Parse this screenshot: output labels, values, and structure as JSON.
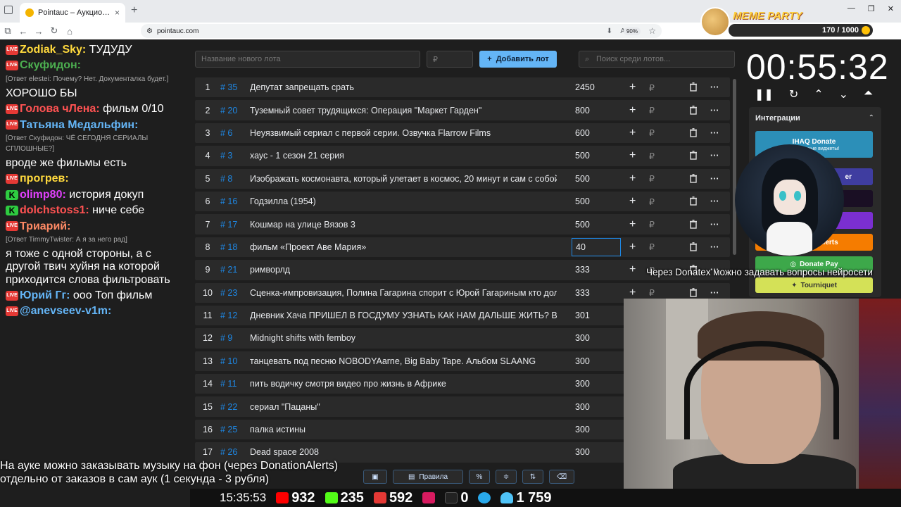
{
  "browser": {
    "tab_title": "Pointauc – Аукционы, лотереи",
    "url": "pointauc.com",
    "zoom": "90%"
  },
  "meme_party": {
    "title": "MEME PARTY",
    "progress": "170 / 1000",
    "progress_fraction": 0.17
  },
  "chat": [
    {
      "nick": "Zodiak_Sky:",
      "color": "#ffd93d",
      "text": "ТУДУДУ",
      "reply": "",
      "badge": "LIVE"
    },
    {
      "nick": "Скуфидон:",
      "color": "#4caf50",
      "text": "",
      "reply": "[Ответ elestei: Почему? Нет. Документалка будет.]",
      "badge": "LIVE"
    },
    {
      "nick": "",
      "color": "#fff",
      "text": "ХОРОШО БЫ",
      "reply": "",
      "badge": ""
    },
    {
      "nick": "Голова чЛена:",
      "color": "#ff5252",
      "text": "фильм 0/10",
      "reply": "",
      "badge": "LIVE"
    },
    {
      "nick": "Татьяна Медальфин:",
      "color": "#64b5f6",
      "text": "",
      "reply": "[Ответ Скуфидон: ЧЁ СЕГОДНЯ СЕРИАЛЫ СПЛОШНЫЕ?]",
      "badge": "LIVE"
    },
    {
      "nick": "",
      "color": "#fff",
      "text": "вроде же фильмы есть",
      "reply": "",
      "badge": ""
    },
    {
      "nick": "прогрев:",
      "color": "#ffd93d",
      "text": "",
      "reply": "",
      "badge": "LIVE"
    },
    {
      "nick": "olimp80:",
      "color": "#e040fb",
      "text": "история докуп",
      "reply": "",
      "badge": "K"
    },
    {
      "nick": "dolchstoss1:",
      "color": "#ff5252",
      "text": "ниче себе",
      "reply": "",
      "badge": "K"
    },
    {
      "nick": "Триарий:",
      "color": "#ff8a65",
      "text": "",
      "reply": "[Ответ TimmyTwister: А я за него рад]",
      "badge": "LIVE"
    },
    {
      "nick": "",
      "color": "#fff",
      "text": "я тоже с одной стороны, а с другой твич хуйня на которой приходится слова фильтровать",
      "reply": "",
      "badge": ""
    },
    {
      "nick": "Юрий Гг:",
      "color": "#64b5f6",
      "text": "ооо Топ фильм",
      "reply": "",
      "badge": "LIVE"
    },
    {
      "nick": "@anevseev-v1m:",
      "color": "#64b5f6",
      "text": "",
      "reply": "",
      "badge": "LIVE"
    }
  ],
  "toolbar": {
    "new_lot_placeholder": "Название нового лота",
    "price_placeholder": "₽",
    "add_label": "Добавить лот",
    "search_placeholder": "Поиск среди лотов..."
  },
  "lots": [
    {
      "n": "1",
      "id": "# 35",
      "name": "Депутат запрещать срать",
      "amount": "2450"
    },
    {
      "n": "2",
      "id": "# 20",
      "name": "Туземный совет трудящихся: Операция \"Маркет Гарден\"",
      "amount": "800"
    },
    {
      "n": "3",
      "id": "# 6",
      "name": "Неуязвимый сериал с первой серии. Озвучка Flarrow Films",
      "amount": "600"
    },
    {
      "n": "4",
      "id": "# 3",
      "name": "хаус - 1 сезон 21 серия",
      "amount": "500"
    },
    {
      "n": "5",
      "id": "# 8",
      "name": "Изображать космонавта, который улетает в космос, 20 минут и сам с собой",
      "amount": "500"
    },
    {
      "n": "6",
      "id": "# 16",
      "name": "Годзилла (1954)",
      "amount": "500"
    },
    {
      "n": "7",
      "id": "# 17",
      "name": "Кошмар на улице Вязов 3",
      "amount": "500"
    },
    {
      "n": "8",
      "id": "# 18",
      "name": "фильм «Проект Аве Мария»",
      "amount": "40"
    },
    {
      "n": "9",
      "id": "# 21",
      "name": "римворлд",
      "amount": "333"
    },
    {
      "n": "10",
      "id": "# 23",
      "name": "Сценка-импровизация, Полина Гагарина спорит с Юрой Гагариным кто дольше",
      "amount": "333"
    },
    {
      "n": "11",
      "id": "# 12",
      "name": "Дневник Хача ПРИШЕЛ В ГОСДУМУ УЗНАТЬ КАК НАМ ДАЛЬШЕ ЖИТЬ? Выпуск",
      "amount": "301"
    },
    {
      "n": "12",
      "id": "# 9",
      "name": "Midnight shifts with femboy",
      "amount": "300"
    },
    {
      "n": "13",
      "id": "# 10",
      "name": "танцевать под песню NOBODYAarne, Big Baby Tape. Альбом SLAANG",
      "amount": "300"
    },
    {
      "n": "14",
      "id": "# 11",
      "name": "пить водичку смотря видео про жизнь в Африке",
      "amount": "300"
    },
    {
      "n": "15",
      "id": "# 22",
      "name": "сериал \"Пацаны\"",
      "amount": "300"
    },
    {
      "n": "16",
      "id": "# 25",
      "name": "палка истины",
      "amount": "300"
    },
    {
      "n": "17",
      "id": "# 26",
      "name": "Dead space 2008",
      "amount": "300"
    }
  ],
  "timer": "00:55:32",
  "integrations": {
    "title": "Интеграции",
    "ihaq_label": "IHAQ Donate",
    "ihaq_sub": "Уникальные виджеты!",
    "alerts_label": "Alerts",
    "donatepay_label": "Donate Pay",
    "tourniquet_label": "Tourniquet",
    "partial_label": "er"
  },
  "overlay_text": "Через Donatex можно задавать вопросы нейросети",
  "subtitle_line1": "На ауке можно заказывать музыку на фон (через DonationAlerts)",
  "subtitle_line2": "отдельно от заказов в сам аук (1 секунда - 3 рубля)",
  "rules_label": "Правила",
  "status": {
    "time": "15:35:53",
    "youtube": "932",
    "kick": "235",
    "vk": "592",
    "rutube": "0",
    "viewers": "1 759"
  }
}
